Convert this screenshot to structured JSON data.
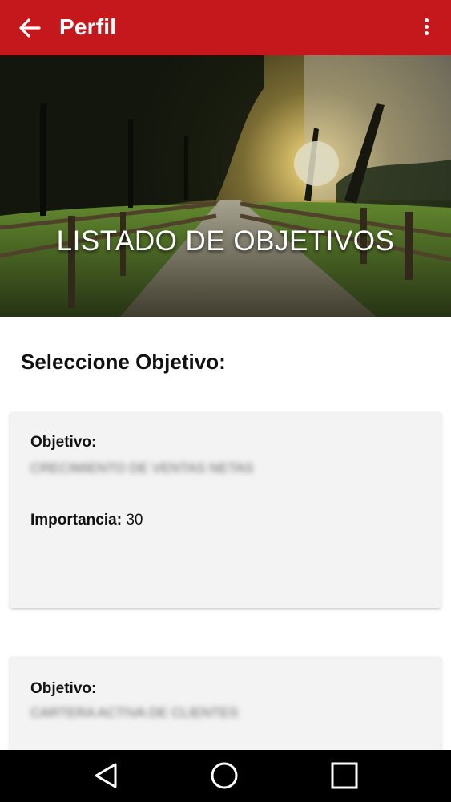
{
  "appbar": {
    "title": "Perfil",
    "back_icon": "arrow-left-icon",
    "menu_icon": "more-vert-icon",
    "color": "#c4181d"
  },
  "hero": {
    "title": "LISTADO DE OBJETIVOS"
  },
  "main": {
    "section_title": "Seleccione Objetivo:",
    "cards": [
      {
        "objective_label": "Objetivo:",
        "objective_value": "CRECIMIENTO DE VENTAS NETAS",
        "importance_label": "Importancia:",
        "importance_value": "30"
      },
      {
        "objective_label": "Objetivo:",
        "objective_value": "CARTERA ACTIVA DE CLIENTES"
      }
    ]
  },
  "navbar": {
    "back_icon": "nav-back-icon",
    "home_icon": "nav-home-icon",
    "recents_icon": "nav-recents-icon"
  }
}
